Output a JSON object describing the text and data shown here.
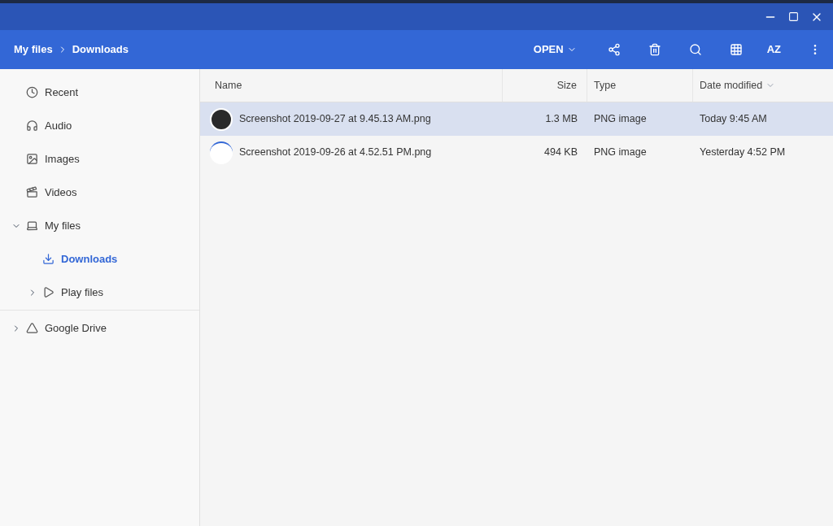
{
  "breadcrumb": [
    "My files",
    "Downloads"
  ],
  "toolbar": {
    "open_label": "OPEN",
    "sort_label": "AZ"
  },
  "sidebar": {
    "sections": [
      {
        "items": [
          {
            "label": "Recent",
            "kind": "recent",
            "selected": false
          },
          {
            "label": "Audio",
            "kind": "audio",
            "selected": false
          },
          {
            "label": "Images",
            "kind": "images",
            "selected": false
          },
          {
            "label": "Videos",
            "kind": "videos",
            "selected": false
          },
          {
            "label": "My files",
            "kind": "device",
            "selected": false,
            "expanded": true,
            "children": [
              {
                "label": "Downloads",
                "kind": "downloads",
                "selected": true
              },
              {
                "label": "Play files",
                "kind": "play",
                "selected": false,
                "expanded": false
              }
            ]
          }
        ]
      },
      {
        "items": [
          {
            "label": "Google Drive",
            "kind": "drive",
            "selected": false,
            "expanded": false
          }
        ]
      }
    ]
  },
  "table": {
    "columns": [
      {
        "label": "Name",
        "sorted": false
      },
      {
        "label": "Size",
        "sorted": false
      },
      {
        "label": "Type",
        "sorted": false
      },
      {
        "label": "Date modified",
        "sorted": true
      }
    ],
    "rows": [
      {
        "name": "Screenshot 2019-09-27 at 9.45.13 AM.png",
        "size": "1.3 MB",
        "type": "PNG image",
        "date": "Today 9:45 AM",
        "selected": true,
        "kind": "dark"
      },
      {
        "name": "Screenshot 2019-09-26 at 4.52.51 PM.png",
        "size": "494 KB",
        "type": "PNG image",
        "date": "Yesterday 4:52 PM",
        "selected": false,
        "kind": "light"
      }
    ]
  }
}
